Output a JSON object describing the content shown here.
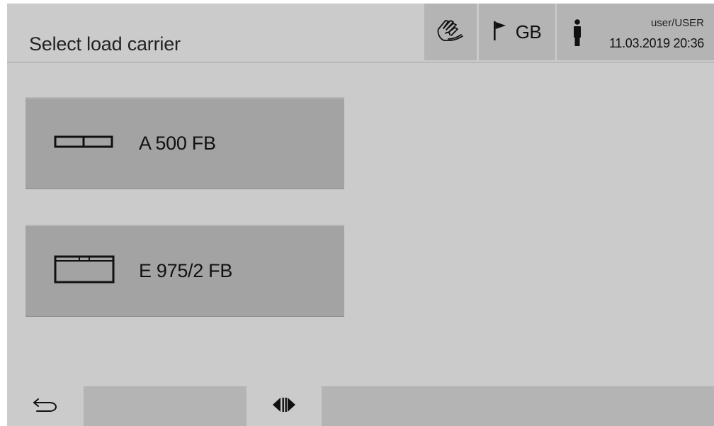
{
  "header": {
    "title": "Select load carrier",
    "language": "GB",
    "user": "user/USER",
    "datetime": "11.03.2019 20:36",
    "icons": {
      "hand": "hand-touch-icon",
      "flag": "flag-icon",
      "user": "person-icon"
    }
  },
  "carriers": [
    {
      "label": "A 500 FB",
      "icon": "carrier-a500-icon"
    },
    {
      "label": "E 975/2 FB",
      "icon": "carrier-e975-icon"
    }
  ],
  "footer": {
    "icons": {
      "back": "back-arrow-icon",
      "split": "split-view-icon"
    }
  },
  "colors": {
    "background": "#cbcbcb",
    "header_button": "#b4b4b4",
    "carrier_button": "#a3a3a3",
    "text": "#111111"
  }
}
